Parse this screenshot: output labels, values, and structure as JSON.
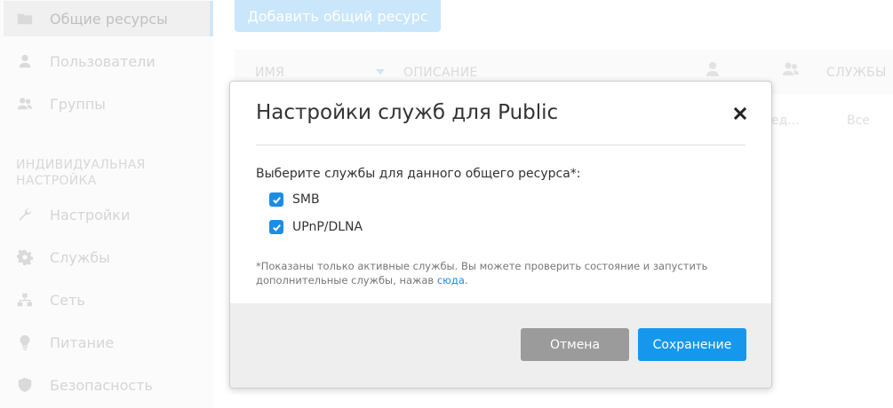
{
  "sidebar": {
    "items": [
      {
        "label": "Общие ресурсы",
        "icon": "folder-icon",
        "active": true
      },
      {
        "label": "Пользователи",
        "icon": "user-icon"
      },
      {
        "label": "Группы",
        "icon": "group-icon"
      },
      {
        "label": "Настройки",
        "icon": "wrench-icon"
      },
      {
        "label": "Службы",
        "icon": "gear-icon"
      },
      {
        "label": "Сеть",
        "icon": "network-icon"
      },
      {
        "label": "Питание",
        "icon": "bulb-icon"
      },
      {
        "label": "Безопасность",
        "icon": "shield-icon"
      }
    ],
    "section_label": "ИНДИВИДУАЛЬНАЯ НАСТРОЙКА"
  },
  "toolbar": {
    "add_label": "Добавить общий ресурс"
  },
  "table": {
    "col_name": "ИМЯ",
    "col_description": "ОПИСАНИЕ",
    "col_services": "СЛУЖБЫ",
    "row_desc_fragment": "ед...",
    "row_services": "Все"
  },
  "modal": {
    "title": "Настройки служб для Public",
    "prompt": "Выберите службы для данного общего ресурса*:",
    "services": [
      {
        "label": "SMB",
        "checked": true
      },
      {
        "label": "UPnP/DLNA",
        "checked": true
      }
    ],
    "note_text": "*Показаны только активные службы. Вы можете проверить состояние и запустить дополнительные службы, нажав ",
    "note_link": "сюда",
    "note_end": ".",
    "cancel_label": "Отмена",
    "save_label": "Сохранение"
  },
  "colors": {
    "accent": "#1597ee",
    "cancel": "#9b9b9b"
  }
}
